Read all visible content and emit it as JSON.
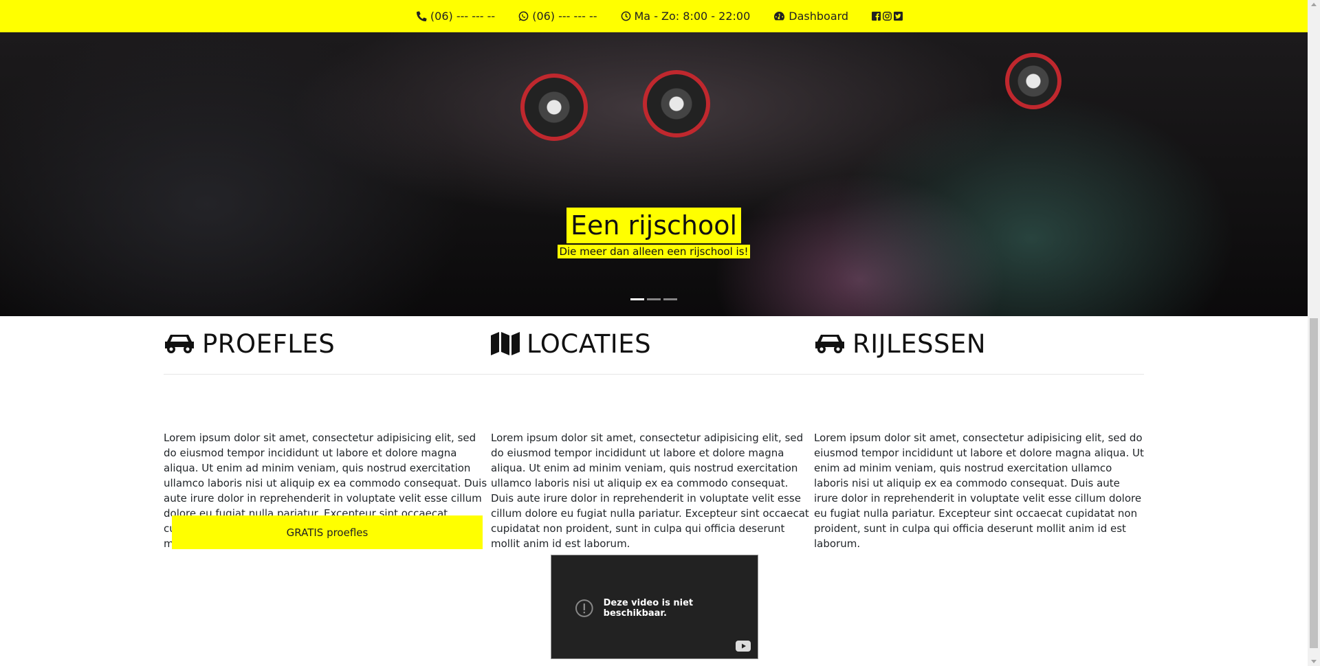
{
  "topbar": {
    "phone": "(06) --- --- --",
    "whatsapp": "(06) --- --- --",
    "hours": "Ma - Zo: 8:00 - 22:00",
    "dashboard": "Dashboard",
    "social_icons": [
      "facebook-icon",
      "instagram-icon",
      "twitter-icon"
    ],
    "background": "#ffff00"
  },
  "hero": {
    "title": "Een rijschool",
    "subtitle": "Die meer dan alleen een rijschool is!",
    "slides": 3,
    "active_slide": 1
  },
  "columns": [
    {
      "icon": "car-icon",
      "title": "PROEFLES",
      "text": "Lorem ipsum dolor sit amet, consectetur adipisicing elit, sed do eiusmod tempor incididunt ut labore et dolore magna aliqua. Ut enim ad minim veniam, quis nostrud exercitation ullamco laboris nisi ut aliquip ex ea commodo consequat. Duis aute irure dolor in reprehenderit in voluptate velit esse cillum dolore eu fugiat nulla pariatur. Excepteur sint occaecat cupidatat non proident, sunt in culpa qui officia deserunt mollit anim id est laborum."
    },
    {
      "icon": "map-icon",
      "title": "LOCATIES",
      "text": "Lorem ipsum dolor sit amet, consectetur adipisicing elit, sed do eiusmod tempor incididunt ut labore et dolore magna aliqua. Ut enim ad minim veniam, quis nostrud exercitation ullamco laboris nisi ut aliquip ex ea commodo consequat. Duis aute irure dolor in reprehenderit in voluptate velit esse cillum dolore eu fugiat nulla pariatur. Excepteur sint occaecat cupidatat non proident, sunt in culpa qui officia deserunt mollit anim id est laborum."
    },
    {
      "icon": "car-icon",
      "title": "RIJLESSEN",
      "text": "Lorem ipsum dolor sit amet, consectetur adipisicing elit, sed do eiusmod tempor incididunt ut labore et dolore magna aliqua. Ut enim ad minim veniam, quis nostrud exercitation ullamco laboris nisi ut aliquip ex ea commodo consequat. Duis aute irure dolor in reprehenderit in voluptate velit esse cillum dolore eu fugiat nulla pariatur. Excepteur sint occaecat cupidatat non proident, sunt in culpa qui officia deserunt mollit anim id est laborum."
    }
  ],
  "cta": {
    "label": "GRATIS proefles"
  },
  "video": {
    "message": "Deze video is niet beschikbaar."
  },
  "colors": {
    "accent": "#ffff00",
    "text": "#212529"
  }
}
